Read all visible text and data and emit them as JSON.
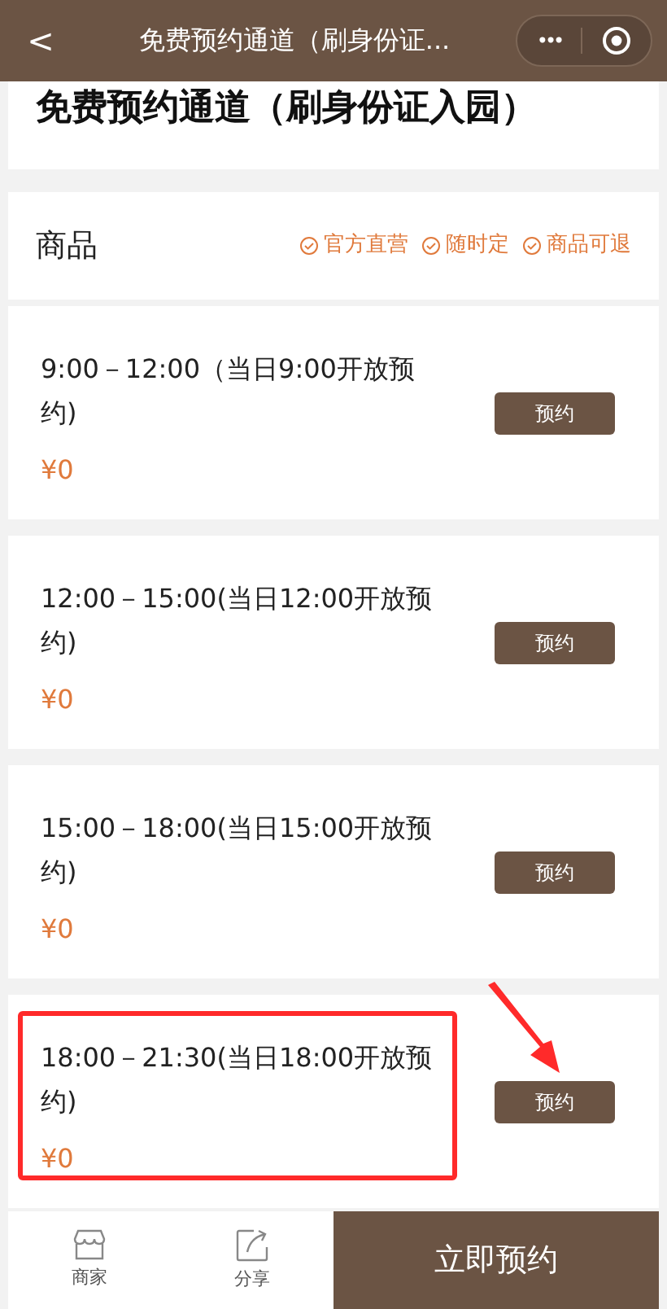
{
  "nav_bar": {
    "back": "<",
    "title": "免费预约通道（刷身份证...",
    "more": "•••"
  },
  "page_title": "免费预约通道（刷身份证入园）",
  "goods_header": {
    "title": "商品",
    "tags": [
      "官方直营",
      "随时定",
      "商品可退"
    ]
  },
  "items": [
    {
      "name": "9:00－12:00（当日9:00开放预约)",
      "price": "¥0",
      "button": "预约",
      "highlighted": false
    },
    {
      "name": "12:00－15:00(当日12:00开放预约)",
      "price": "¥0",
      "button": "预约",
      "highlighted": false
    },
    {
      "name": "15:00－18:00(当日15:00开放预约)",
      "price": "¥0",
      "button": "预约",
      "highlighted": false
    },
    {
      "name": "18:00－21:30(当日18:00开放预约)",
      "price": "¥0",
      "button": "预约",
      "highlighted": true
    }
  ],
  "bottom_bar": {
    "shop": "商家",
    "share": "分享",
    "book": "立即预约"
  }
}
